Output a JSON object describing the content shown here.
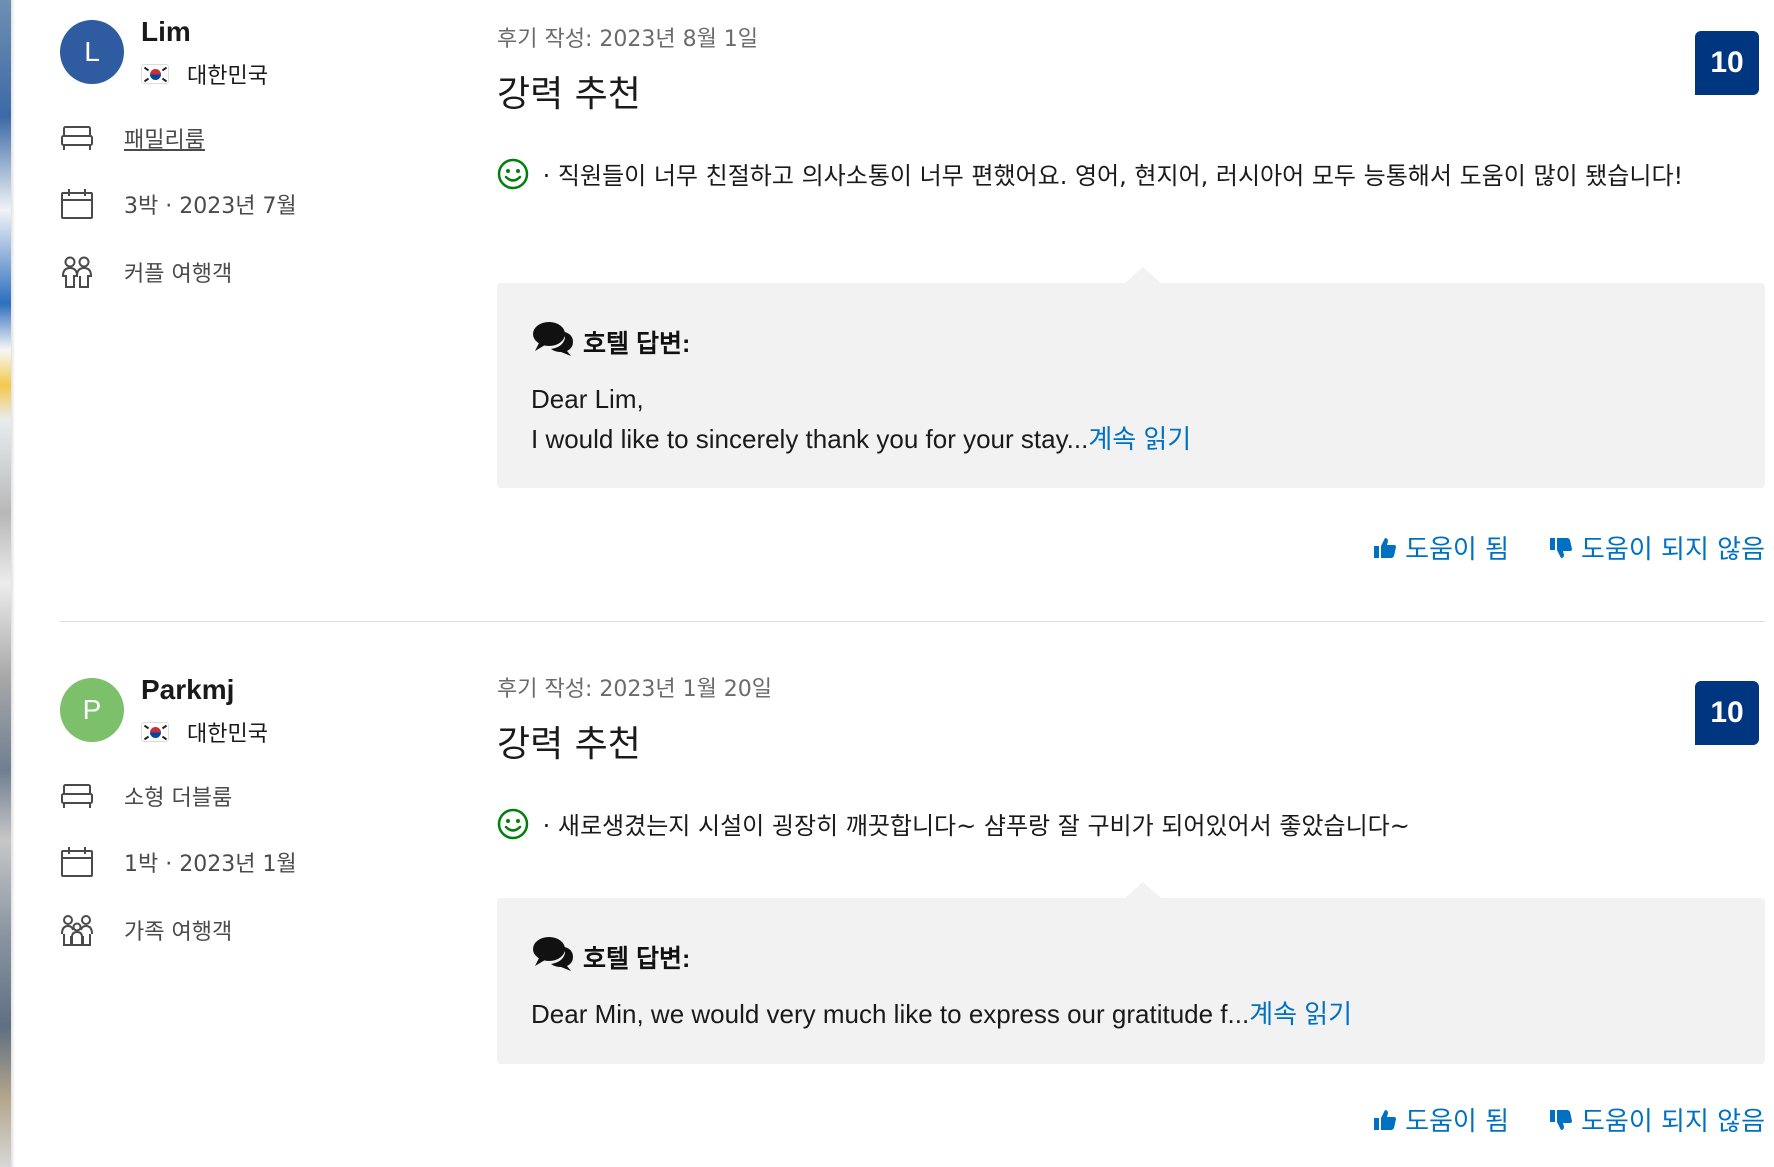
{
  "reviews": [
    {
      "avatar_initial": "L",
      "name": "Lim",
      "country": "대한민국",
      "room": "패밀리룸",
      "stay": "3박 ·  2023년 7월",
      "traveler_type": "커플 여행객",
      "date": "후기 작성: 2023년 8월 1일",
      "title": "강력 추천",
      "score": "10",
      "positive_text": " · 직원들이 너무 친절하고 의사소통이 너무 편했어요. 영어, 현지어, 러시아어 모두 능통해서 도움이 많이 됐습니다!",
      "reply_heading": "호텔 답변:",
      "reply_line1": "Dear Lim,",
      "reply_line2": "I would like to sincerely thank you for your stay...",
      "read_more": "계속 읽기",
      "helpful": "도움이 됨",
      "not_helpful": "도움이 되지 않음"
    },
    {
      "avatar_initial": "P",
      "name": "Parkmj",
      "country": "대한민국",
      "room": "소형 더블룸",
      "stay": "1박 ·  2023년 1월",
      "traveler_type": "가족 여행객",
      "date": "후기 작성: 2023년 1월 20일",
      "title": "강력 추천",
      "score": "10",
      "positive_text": " · 새로생겼는지 시설이 굉장히 깨끗합니다~ 샴푸랑 잘 구비가 되어있어서 좋았습니다~",
      "reply_heading": "호텔 답변:",
      "reply_line1": "Dear Min, we would very much like to express our gratitude f...",
      "read_more": "계속 읽기",
      "helpful": "도움이 됨",
      "not_helpful": "도움이 되지 않음"
    }
  ],
  "colors": {
    "score_bg": "#003580",
    "link": "#0071c2",
    "positive_icon": "#008009",
    "avatar_blue": "#2f5ba0",
    "avatar_green": "#7cc06c",
    "reply_bg": "#f2f2f2"
  },
  "icons": {
    "room": "bed-icon",
    "stay": "calendar-icon",
    "traveler_couple": "couple-icon",
    "traveler_family": "family-icon",
    "positive": "smile-icon",
    "reply": "chat-bubbles-icon",
    "helpful": "thumbs-up-icon",
    "not_helpful": "thumbs-down-icon"
  }
}
